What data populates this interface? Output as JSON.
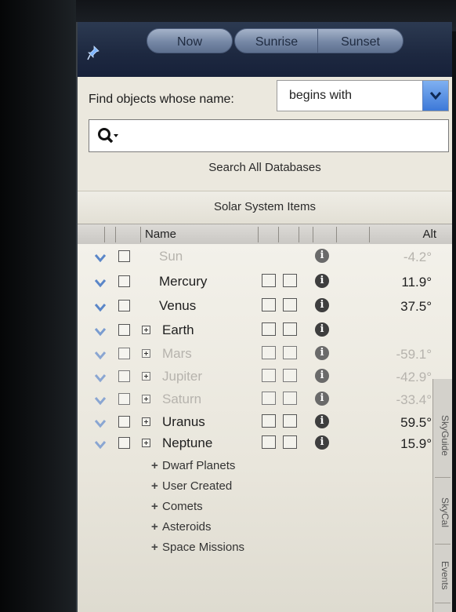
{
  "toolbar": {
    "buttons": [
      {
        "label": "Now"
      },
      {
        "label": "Sunrise"
      },
      {
        "label": "Sunset"
      }
    ]
  },
  "find": {
    "label": "Find objects whose name:",
    "match_mode": "begins with",
    "search_value": "",
    "search_all_label": "Search All Databases"
  },
  "section_title": "Solar System Items",
  "columns": {
    "name": "Name",
    "alt": "Alt"
  },
  "rows": [
    {
      "name": "Sun",
      "alt": "-4.2°"
    },
    {
      "name": "Mercury",
      "alt": "11.9°"
    },
    {
      "name": "Venus",
      "alt": "37.5°"
    },
    {
      "name": "Earth",
      "alt": ""
    },
    {
      "name": "Mars",
      "alt": "-59.1°"
    },
    {
      "name": "Jupiter",
      "alt": "-42.9°"
    },
    {
      "name": "Saturn",
      "alt": "-33.4°"
    },
    {
      "name": "Uranus",
      "alt": "59.5°"
    },
    {
      "name": "Neptune",
      "alt": "15.9°"
    }
  ],
  "groups": [
    "Dwarf Planets",
    "User Created",
    "Comets",
    "Asteroids",
    "Space Missions"
  ],
  "side_tabs": [
    "SkyGuide",
    "SkyCal",
    "Events"
  ],
  "colors": {
    "accent": "#3d79d8",
    "toolbar": "#1d2840",
    "faded_text": "#b6b3ad"
  }
}
